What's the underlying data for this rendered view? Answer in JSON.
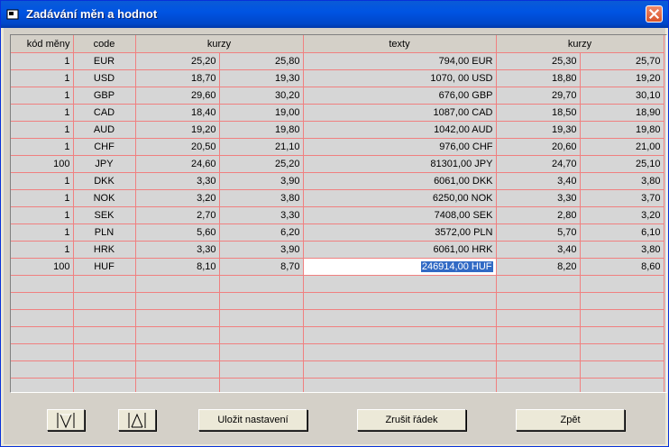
{
  "window": {
    "title": "Zadávání měn a hodnot"
  },
  "grid": {
    "headers": {
      "kod_meny": "kód měny",
      "code": "code",
      "kurzy1": "kurzy",
      "texty": "texty",
      "kurzy2": "kurzy"
    },
    "rows": [
      [
        "1",
        "EUR",
        "25,20",
        "25,80",
        "794,00 EUR",
        "25,30",
        "25,70"
      ],
      [
        "1",
        "USD",
        "18,70",
        "19,30",
        "1070, 00 USD",
        "18,80",
        "19,20"
      ],
      [
        "1",
        "GBP",
        "29,60",
        "30,20",
        "676,00 GBP",
        "29,70",
        "30,10"
      ],
      [
        "1",
        "CAD",
        "18,40",
        "19,00",
        "1087,00 CAD",
        "18,50",
        "18,90"
      ],
      [
        "1",
        "AUD",
        "19,20",
        "19,80",
        "1042,00 AUD",
        "19,30",
        "19,80"
      ],
      [
        "1",
        "CHF",
        "20,50",
        "21,10",
        "976,00 CHF",
        "20,60",
        "21,00"
      ],
      [
        "100",
        "JPY",
        "24,60",
        "25,20",
        "81301,00 JPY",
        "24,70",
        "25,10"
      ],
      [
        "1",
        "DKK",
        "3,30",
        "3,90",
        "6061,00 DKK",
        "3,40",
        "3,80"
      ],
      [
        "1",
        "NOK",
        "3,20",
        "3,80",
        "6250,00 NOK",
        "3,30",
        "3,70"
      ],
      [
        "1",
        "SEK",
        "2,70",
        "3,30",
        "7408,00 SEK",
        "2,80",
        "3,20"
      ],
      [
        "1",
        "PLN",
        "5,60",
        "6,20",
        "3572,00 PLN",
        "5,70",
        "6,10"
      ],
      [
        "1",
        "HRK",
        "3,30",
        "3,90",
        "6061,00 HRK",
        "3,40",
        "3,80"
      ],
      [
        "100",
        "HUF",
        "8,10",
        "8,70",
        "246914,00 HUF",
        "8,20",
        "8,60"
      ]
    ],
    "empty_rows": 7
  },
  "buttons": {
    "move_down_icon": "arrow-down-icon",
    "move_up_icon": "arrow-up-icon",
    "save": "Uložit nastavení",
    "delete_row": "Zrušit řádek",
    "back": "Zpět"
  }
}
